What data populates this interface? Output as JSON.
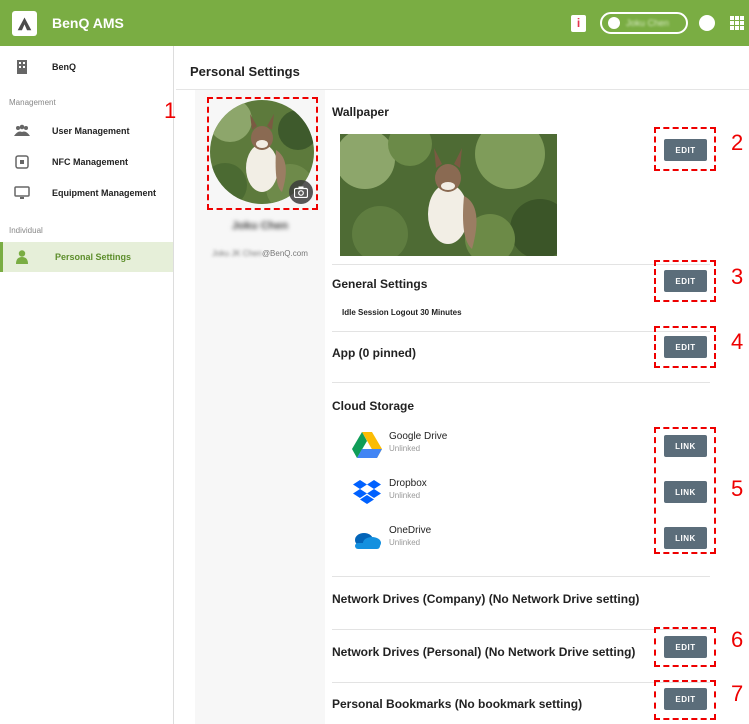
{
  "header": {
    "app_title": "BenQ AMS",
    "user_name": "Joku Chen",
    "notification_icon": "i"
  },
  "sidebar": {
    "org": "BenQ",
    "section_management": "Management",
    "management_items": [
      "User Management",
      "NFC Management",
      "Equipment Management"
    ],
    "section_individual": "Individual",
    "individual_items": [
      "Personal Settings"
    ]
  },
  "page": {
    "title": "Personal Settings"
  },
  "profile": {
    "name": "Joku Chen",
    "email_blur": "Joku JK Chen",
    "email_domain": "@BenQ.com"
  },
  "sections": {
    "wallpaper": "Wallpaper",
    "general": "General Settings",
    "general_detail": "Idle Session Logout 30 Minutes",
    "app": "App (0 pinned)",
    "cloud": "Cloud Storage",
    "network_company": "Network Drives (Company) (No Network Drive setting)",
    "network_personal": "Network Drives (Personal) (No Network Drive setting)",
    "bookmarks": "Personal Bookmarks (No bookmark setting)"
  },
  "cloud_services": [
    {
      "name": "Google Drive",
      "status": "Unlinked"
    },
    {
      "name": "Dropbox",
      "status": "Unlinked"
    },
    {
      "name": "OneDrive",
      "status": "Unlinked"
    }
  ],
  "buttons": {
    "edit": "EDIT",
    "link": "LINK"
  },
  "callouts": [
    "1",
    "2",
    "3",
    "4",
    "5",
    "6",
    "7"
  ],
  "colors": {
    "brand_green": "#7aad43",
    "button": "#5b6d7a",
    "callout_red": "#e00000"
  }
}
